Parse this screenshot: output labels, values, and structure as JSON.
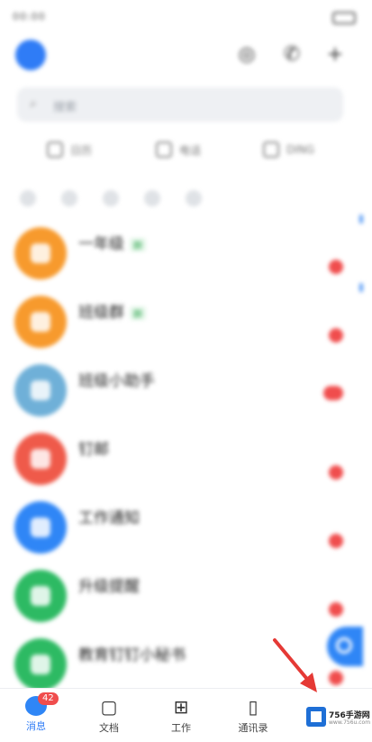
{
  "status_bar": {
    "time": "00:00"
  },
  "search": {
    "placeholder": "搜索"
  },
  "quick_actions": [
    {
      "label": "日历",
      "icon": "calendar-icon"
    },
    {
      "label": "电话",
      "icon": "phone-icon"
    },
    {
      "label": "DING",
      "icon": "ding-icon"
    }
  ],
  "conversations": [
    {
      "title": "一年级",
      "tag": "群",
      "preview": "",
      "time": "",
      "color": "#f79a2d",
      "unread_badge": true
    },
    {
      "title": "班级群",
      "tag": "群",
      "preview": "",
      "time": "",
      "color": "#f79a2d",
      "unread_badge": true
    },
    {
      "title": "班级小助手",
      "tag": "",
      "preview": "",
      "time": "",
      "color": "#6fb0d8",
      "unread_badge": true
    },
    {
      "title": "钉邮",
      "tag": "",
      "preview": "",
      "time": "",
      "color": "#ef5a4a",
      "unread_badge": true
    },
    {
      "title": "工作通知",
      "tag": "",
      "preview": "",
      "time": "",
      "color": "#2f86f6",
      "unread_badge": true
    },
    {
      "title": "升级提醒",
      "tag": "",
      "preview": "",
      "time": "",
      "color": "#2dba63",
      "unread_badge": true
    },
    {
      "title": "教育钉钉小秘书",
      "tag": "",
      "preview": "",
      "time": "",
      "color": "#2dba63",
      "unread_badge": true
    }
  ],
  "tabs": [
    {
      "label": "消息",
      "icon": "message-icon",
      "active": true,
      "badge": "42"
    },
    {
      "label": "文档",
      "icon": "document-icon",
      "active": false
    },
    {
      "label": "工作",
      "icon": "work-grid-icon",
      "active": false
    },
    {
      "label": "通讯录",
      "icon": "contacts-icon",
      "active": false
    }
  ],
  "watermark": {
    "text": "756手游网",
    "sub": "www.756u.com"
  },
  "colors": {
    "accent": "#2f7cf6",
    "badge": "#f04d4d",
    "annotation_arrow": "#e53935"
  }
}
